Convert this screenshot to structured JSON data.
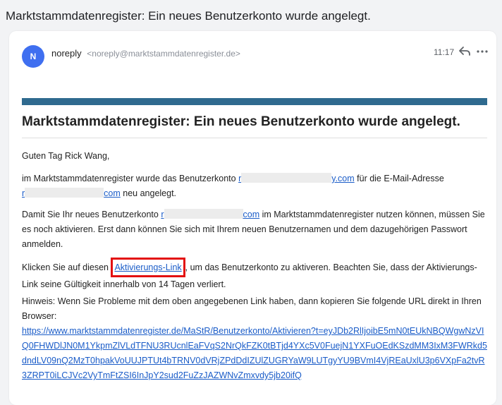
{
  "subject": "Marktstammdatenregister: Ein neues Benutzerkonto wurde angelegt.",
  "sender": {
    "avatar_letter": "N",
    "name": "noreply",
    "email": "<noreply@marktstammdatenregister.de>",
    "time": "11:17"
  },
  "icons": {
    "reply": "reply-icon",
    "more": "more-horizontal-icon"
  },
  "colors": {
    "accent_bar": "#2f6a8f",
    "link": "#1a5cc8",
    "highlight_box": "#e31010",
    "avatar": "#3f6ff0"
  },
  "body": {
    "heading": "Marktstammdatenregister: Ein neues Benutzerkonto wurde angelegt.",
    "greeting": "Guten Tag Rick Wang,",
    "p1_a": "im Marktstammdatenregister wurde das Benutzerkonto ",
    "p1_link1_prefix": "r",
    "p1_link1_suffix": "y.com",
    "p1_b": " für die E-Mail-Adresse",
    "p1_link2_prefix": "r",
    "p1_link2_suffix": "com",
    "p1_c": " neu angelegt.",
    "p2_a": "Damit Sie Ihr neues Benutzerkonto ",
    "p2_link_prefix": "r",
    "p2_link_suffix": "com",
    "p2_b": " im Marktstammdatenregister nutzen können, müssen Sie es noch aktivieren. Erst dann können Sie sich mit Ihrem neuen Benutzernamen und dem dazugehörigen Passwort anmelden.",
    "p3_a": "Klicken Sie auf diesen ",
    "p3_link": "Aktivierungs-Link",
    "p3_b": ", um das Benutzerkonto zu aktiveren. Beachten Sie, dass der Aktivierungs-Link seine Gültigkeit innerhalb von 14 Tagen verliert.",
    "p4": "Hinweis: Wenn Sie Probleme mit dem oben angegebenen Link haben, dann kopieren Sie folgende URL direkt in Ihren Browser:",
    "url": "https://www.marktstammdatenregister.de/MaStR/Benutzerkonto/Aktivieren?t=eyJDb2RlIjoibE5mN0tEUkNBQWgwNzVIQ0FHWDlJN0M1YkpmZlVLdTFNU3RUcnlEaFVqS2NrQkFZK0tBTjd4YXc5V0FuejN1YXFuOEdKSzdMM3IxM3FWRkd5dndLV09nQ2MzT0hpakVoUUJPTUt4bTRNV0dVRjZPdDdIZUlZUGRYaW9LUTgyYU9BVmI4VjREaUxlU3p6VXpFa2tvR3ZRPT0iLCJVc2VyTmFtZSI6InJpY2sud2FuZzJAZWNvZmxvdy5jb20ifQ"
  }
}
